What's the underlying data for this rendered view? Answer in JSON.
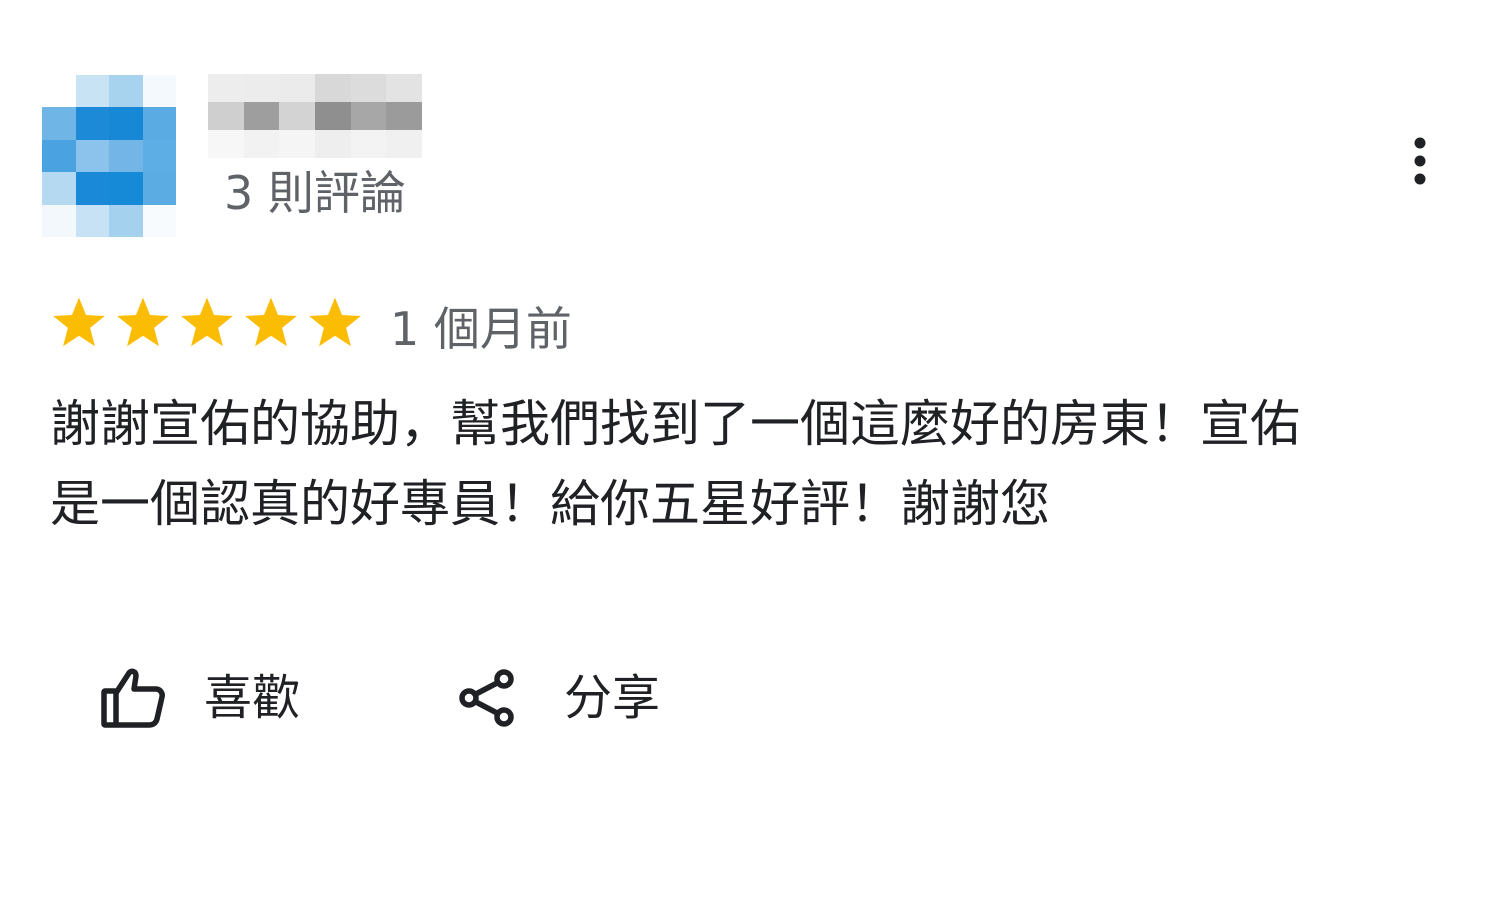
{
  "reviewer": {
    "review_count_label": "3 則評論"
  },
  "review": {
    "rating": 5,
    "rating_max": 5,
    "star_color": "#fbbc04",
    "time_ago": "1 個月前",
    "text_lines": [
      "謝謝宣佑的協助，幫我們找到了一個這麼好的房東！宣佑",
      "是一個認真的好專員！給你五星好評！謝謝您"
    ]
  },
  "actions": {
    "like_label": "喜歡",
    "share_label": "分享"
  },
  "icons": {
    "more": "more-vert-icon",
    "like": "thumb-up-icon",
    "share": "share-icon"
  }
}
